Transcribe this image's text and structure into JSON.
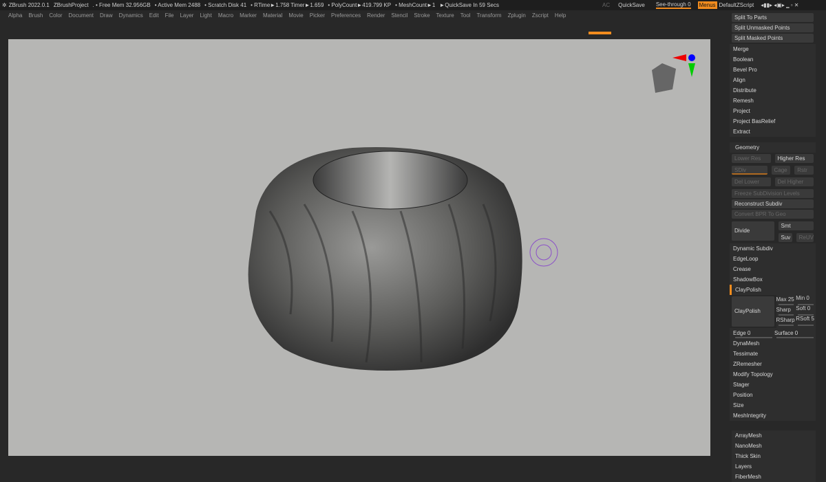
{
  "titlebar": {
    "app": "ZBrush 2022.0.1",
    "project": "ZBrushProject",
    "free_mem": ". • Free Mem 32.956GB",
    "active_mem": "• Active Mem 2488",
    "scratch": "• Scratch Disk 41",
    "rtime": "• RTime►1.758 Timer►1.659",
    "poly": "• PolyCount►419.799 KP",
    "mesh": "• MeshCount►1",
    "quicksave_in": "►QuickSave In 59 Secs",
    "ac": "AC",
    "quicksave": "QuickSave",
    "see_through": "See-through  0",
    "menus": "Menus",
    "script": "DefaultZScript"
  },
  "menu": [
    "Alpha",
    "Brush",
    "Color",
    "Document",
    "Draw",
    "Dynamics",
    "Edit",
    "File",
    "Layer",
    "Light",
    "Macro",
    "Marker",
    "Material",
    "Movie",
    "Picker",
    "Preferences",
    "Render",
    "Stencil",
    "Stroke",
    "Texture",
    "Tool",
    "Transform",
    "Zplugin",
    "Zscript",
    "Help"
  ],
  "panel": {
    "split_buttons": [
      "Split To Parts",
      "Split Unmasked Points",
      "Split Masked Points"
    ],
    "items": [
      "Merge",
      "Boolean",
      "Bevel Pro",
      "Align",
      "Distribute",
      "Remesh",
      "Project",
      "Project BasRelief",
      "Extract"
    ],
    "geometry": {
      "title": "Geometry",
      "lower_res": "Lower Res",
      "higher_res": "Higher Res",
      "sdiv": "SDiv",
      "cage": "Cage",
      "rstr": "Rstr",
      "del_lower": "Del Lower",
      "del_higher": "Del Higher",
      "freeze": "Freeze SubDivision Levels",
      "reconstruct": "Reconstruct Subdiv",
      "convert": "Convert BPR To Geo",
      "divide": "Divide",
      "smt": "Smt",
      "suv": "Suv",
      "reuv": "ReUV",
      "dynamic_subdiv": "Dynamic Subdiv",
      "edgeloop": "EdgeLoop",
      "crease": "Crease",
      "shadowbox": "ShadowBox",
      "claypolish_header": "ClayPolish",
      "claypolish_btn": "ClayPolish",
      "max": "Max 25",
      "min": "Min 0",
      "sharp": "Sharp",
      "soft": "Soft 0",
      "rsharp": "RSharp",
      "rsoft": "RSoft 5",
      "edge": "Edge 0",
      "surface": "Surface 0",
      "items": [
        "DynaMesh",
        "Tessimate",
        "ZRemesher",
        "Modify Topology",
        "Stager",
        "Position",
        "Size",
        "MeshIntegrity"
      ]
    },
    "bottom": [
      "ArrayMesh",
      "NanoMesh",
      "Thick Skin",
      "Layers",
      "FiberMesh"
    ]
  },
  "colors": {
    "accent": "#f28c1e",
    "viewport": "#b6b6b4"
  }
}
